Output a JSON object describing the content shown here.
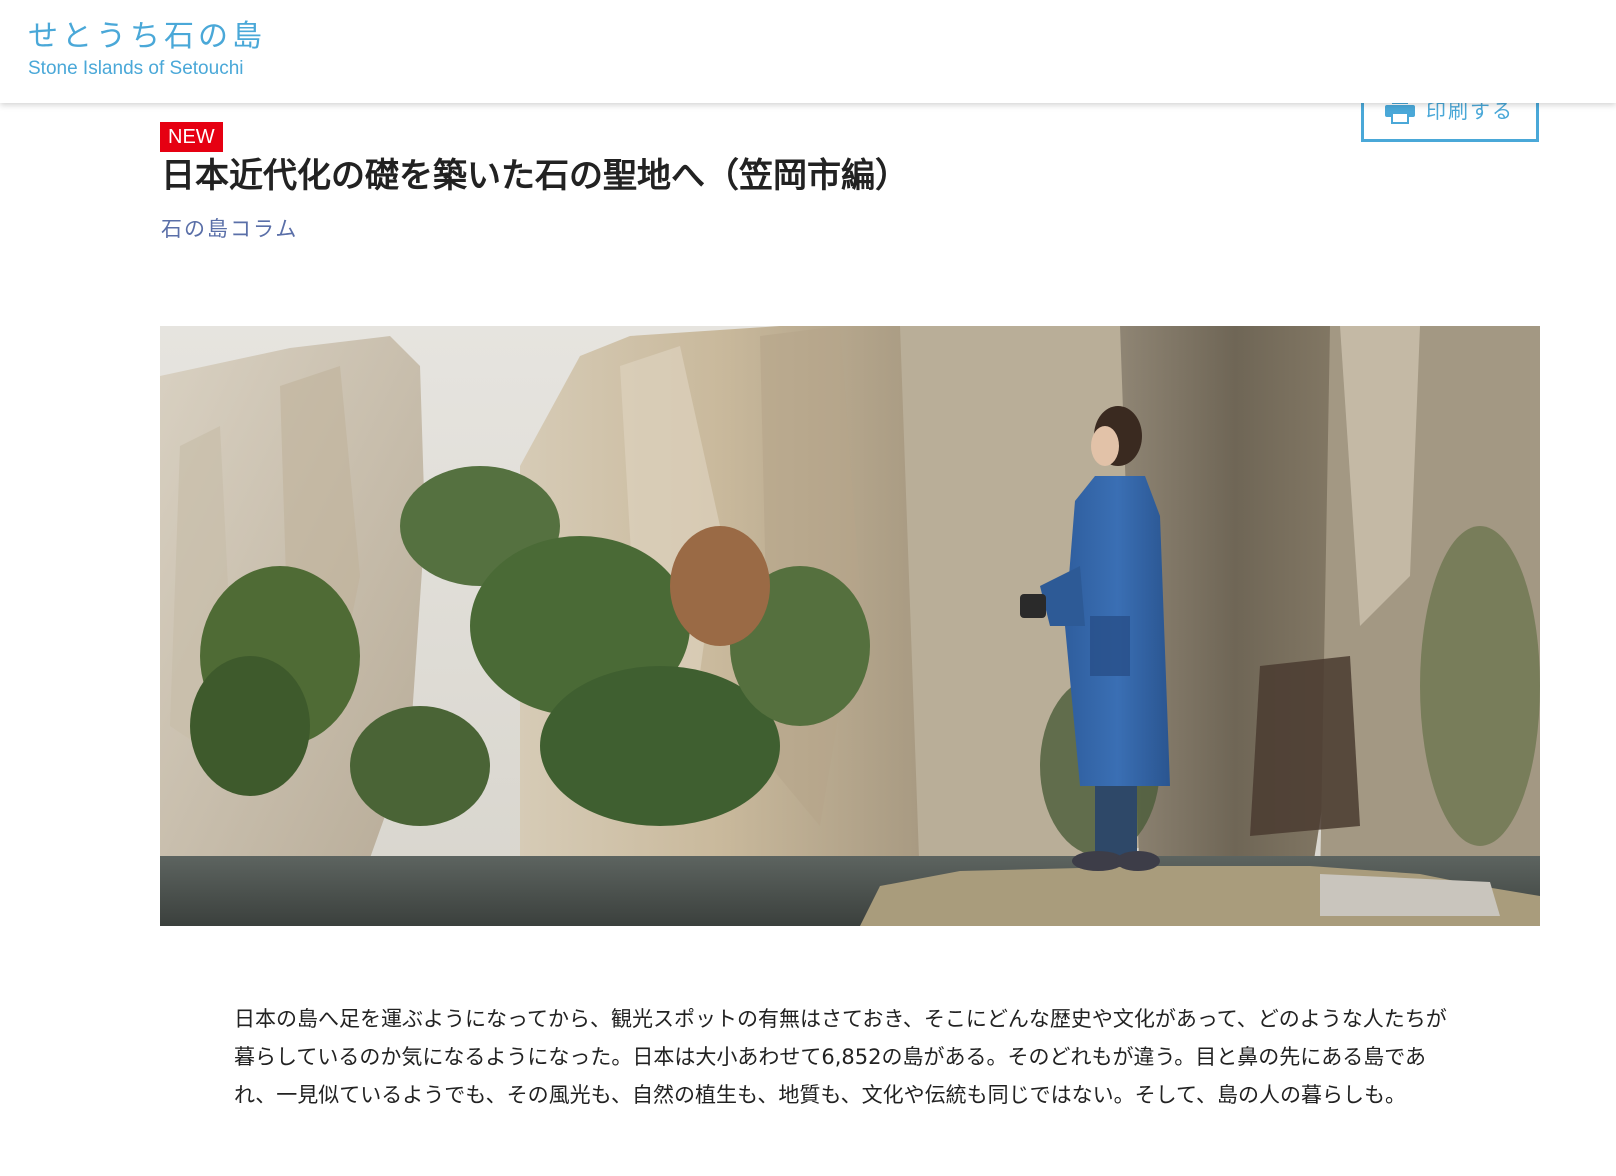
{
  "header": {
    "logo_jp": "せとうち石の島",
    "logo_en": "Stone Islands of Setouchi"
  },
  "print": {
    "label": "印刷する",
    "icon": "printer-icon"
  },
  "article": {
    "badge": "NEW",
    "title": "日本近代化の礎を築いた石の聖地へ（笠岡市編）",
    "category": "石の島コラム",
    "intro": "日本の島へ足を運ぶようになってから、観光スポットの有無はさておき、そこにどんな歴史や文化があって、どのような人たちが暮らしているのか気になるようになった。日本は大小あわせて6,852の島がある。そのどれもが違う。目と鼻の先にある島であれ、一見似ているようでも、その風光も、自然の植生も、地質も、文化や伝統も同じではない。そして、島の人の暮らしも。"
  },
  "colors": {
    "brand": "#4aa8d8",
    "badge": "#e60012",
    "category": "#5a6fa8"
  }
}
